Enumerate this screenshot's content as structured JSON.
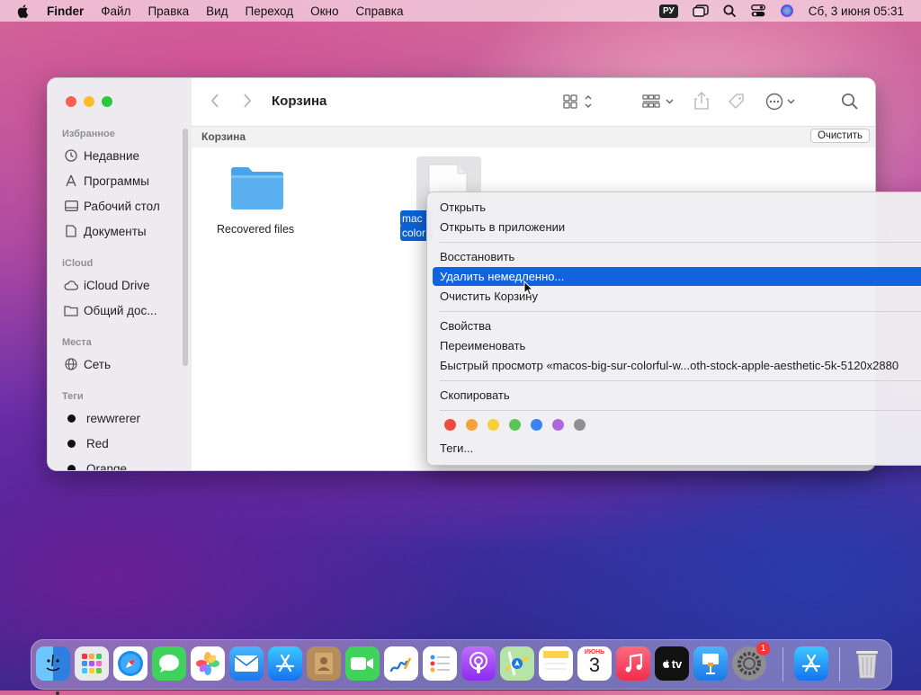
{
  "menubar": {
    "app_name": "Finder",
    "items": [
      "Файл",
      "Правка",
      "Вид",
      "Переход",
      "Окно",
      "Справка"
    ],
    "input_source": "РУ",
    "clock": "Сб, 3 июня  05:31"
  },
  "window": {
    "title": "Корзина",
    "path_title": "Корзина",
    "clear_button": "Очистить"
  },
  "sidebar": {
    "sections": [
      {
        "header": "Избранное",
        "items": [
          "Недавние",
          "Программы",
          "Рабочий стол",
          "Документы"
        ]
      },
      {
        "header": "iCloud",
        "items": [
          "iCloud Drive",
          "Общий дос..."
        ]
      },
      {
        "header": "Места",
        "items": [
          "Сеть"
        ]
      },
      {
        "header": "Теги",
        "items": [
          "rewwrerer",
          "Red",
          "Orange"
        ]
      }
    ]
  },
  "files": [
    {
      "name": "Recovered files",
      "kind": "folder"
    },
    {
      "name": "macos-big-sur-colorful",
      "kind": "image",
      "label_line1": "mac",
      "label_line2": "color",
      "selected": true
    }
  ],
  "context_menu": {
    "items": [
      {
        "label": "Открыть"
      },
      {
        "label": "Открыть в приложении"
      },
      {
        "separator": true
      },
      {
        "label": "Восстановить"
      },
      {
        "label": "Удалить немедленно...",
        "highlighted": true
      },
      {
        "label": "Очистить Корзину"
      },
      {
        "separator": true
      },
      {
        "label": "Свойства"
      },
      {
        "label": "Переименовать"
      },
      {
        "label": "Быстрый просмотр «macos-big-sur-colorful-w...oth-stock-apple-aesthetic-5k-5120x2880"
      },
      {
        "separator": true
      },
      {
        "label": "Скопировать"
      },
      {
        "separator": true
      },
      {
        "label": "Теги..."
      }
    ],
    "tag_colors": [
      "#ef4b3c",
      "#f6a23b",
      "#f6cf3d",
      "#5cc55a",
      "#3b82f6",
      "#b067dd",
      "#8e8e93"
    ]
  },
  "dock": {
    "apps": [
      "finder",
      "launchpad",
      "safari",
      "messages",
      "photos",
      "mail",
      "app-store",
      "contacts",
      "facetime",
      "freeform",
      "reminders",
      "podcasts",
      "maps",
      "notes",
      "calendar",
      "music",
      "apple-tv",
      "keynote",
      "system-settings",
      "app-store-2",
      "trash"
    ],
    "calendar_month": "ИЮНЬ",
    "calendar_day": "3",
    "settings_badge": "1",
    "tv_label": "tv"
  },
  "colors": {
    "accent": "#1163e0",
    "selection": "#0a62d5",
    "folder": "#5ab0f0"
  }
}
